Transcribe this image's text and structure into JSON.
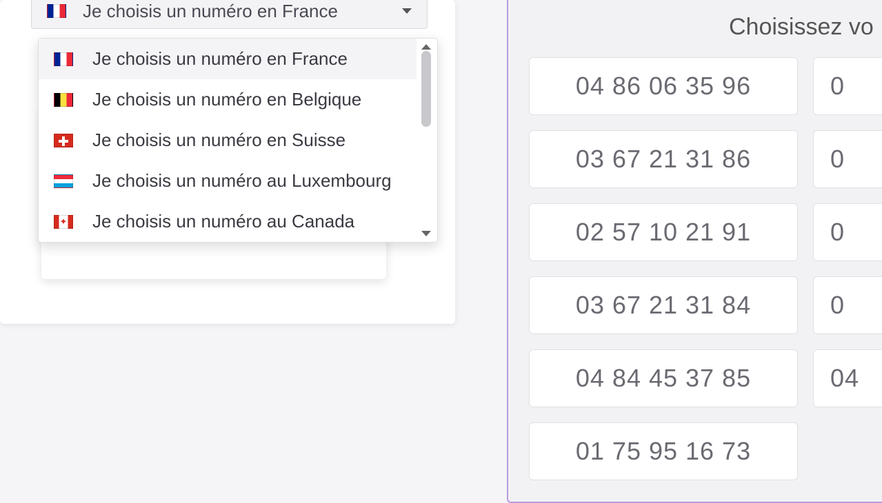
{
  "countrySelect": {
    "selected": {
      "flag": "fr",
      "label": "Je choisis un numéro en France"
    },
    "options": [
      {
        "flag": "fr",
        "label": "Je choisis un numéro en France",
        "active": true
      },
      {
        "flag": "be",
        "label": "Je choisis un numéro en Belgique"
      },
      {
        "flag": "ch",
        "label": "Je choisis un numéro en Suisse"
      },
      {
        "flag": "lu",
        "label": "Je choisis un numéro au Luxembourg"
      },
      {
        "flag": "ca",
        "label": "Je choisis un numéro au Canada"
      }
    ]
  },
  "rightPanel": {
    "title": "Choisissez vo",
    "numbers": {
      "col1": [
        "04 86 06 35 96",
        "03 67 21 31 86",
        "02 57 10 21 91",
        "03 67 21 31 84",
        "04 84 45 37 85",
        "01 75 95 16 73"
      ],
      "col2Partial": [
        "0",
        "0",
        "0",
        "0",
        "04",
        ""
      ]
    }
  }
}
